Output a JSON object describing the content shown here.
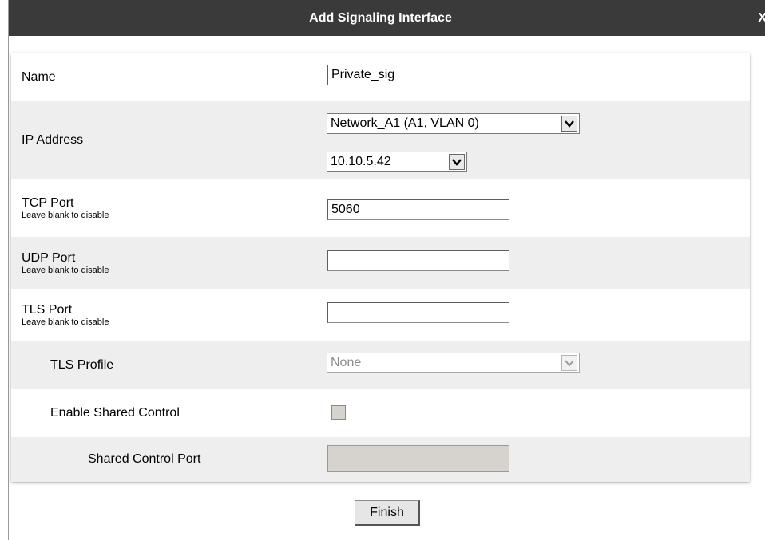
{
  "dialog": {
    "title": "Add Signaling Interface",
    "close_label": "X"
  },
  "fields": {
    "name": {
      "label": "Name",
      "value": "Private_sig"
    },
    "ip_address": {
      "label": "IP Address",
      "network_value": "Network_A1 (A1, VLAN 0)",
      "ip_value": "10.10.5.42"
    },
    "tcp_port": {
      "label": "TCP Port",
      "hint": "Leave blank to disable",
      "value": "5060"
    },
    "udp_port": {
      "label": "UDP Port",
      "hint": "Leave blank to disable",
      "value": ""
    },
    "tls_port": {
      "label": "TLS Port",
      "hint": "Leave blank to disable",
      "value": ""
    },
    "tls_profile": {
      "label": "TLS Profile",
      "value": "None"
    },
    "enable_shared_control": {
      "label": "Enable Shared Control",
      "checked": false
    },
    "shared_control_port": {
      "label": "Shared Control Port",
      "value": ""
    }
  },
  "actions": {
    "finish_label": "Finish"
  },
  "colors": {
    "titlebar": "#3a3a3a",
    "row_alt": "#eeeeee",
    "disabled_fill": "#d6d3ce"
  }
}
